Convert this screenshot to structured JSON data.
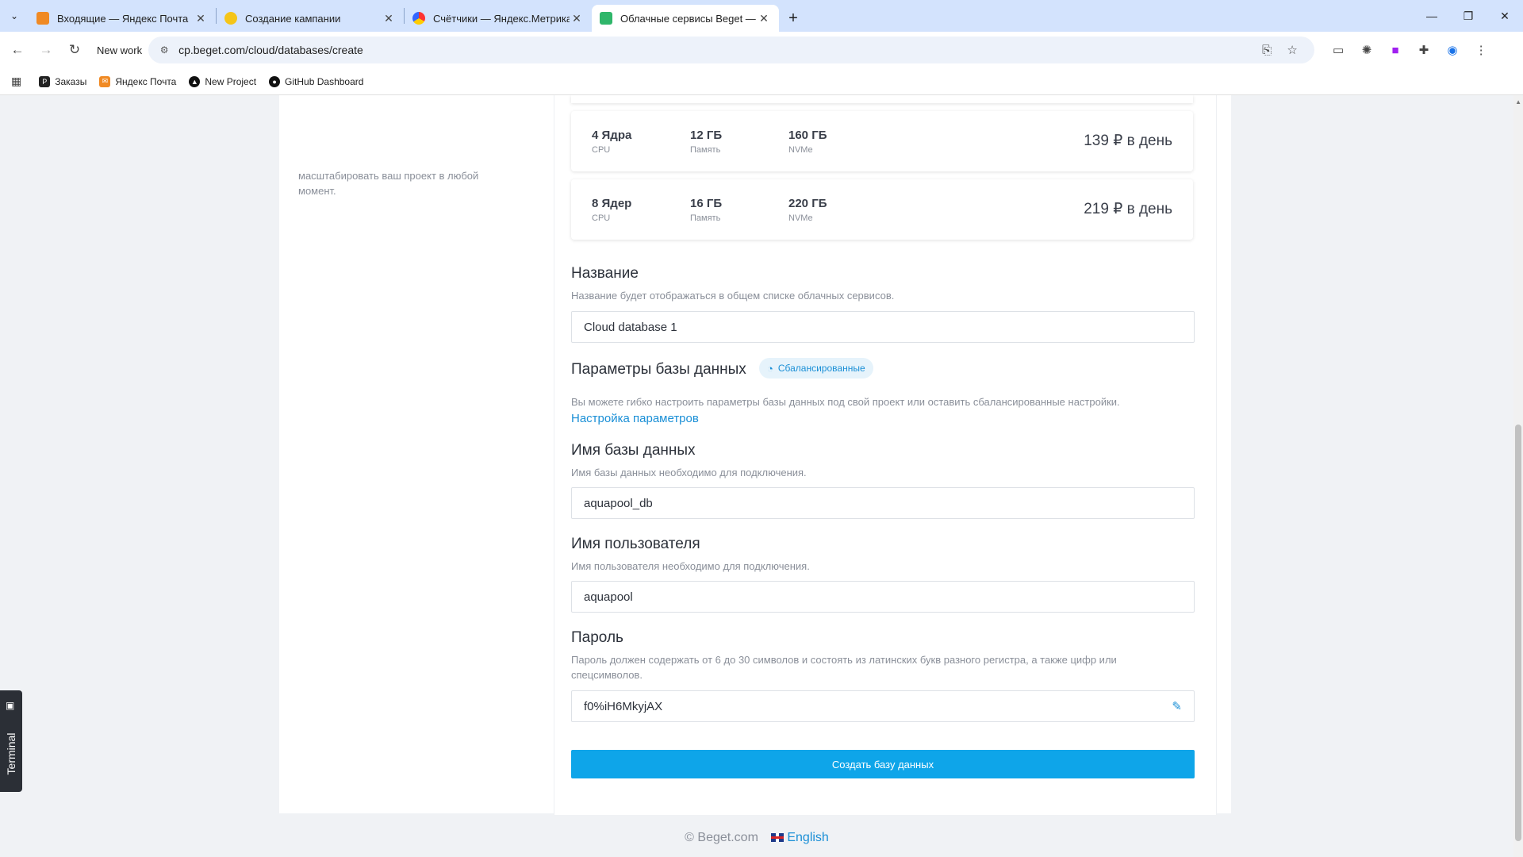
{
  "browser": {
    "tabs": [
      {
        "title": "Входящие — Яндекс Почта",
        "favicon_color": "#f08a24"
      },
      {
        "title": "Создание кампании",
        "favicon_color": "#f5c518"
      },
      {
        "title": "Счётчики — Яндекс.Метрика",
        "favicon_color": "#7a5cff"
      },
      {
        "title": "Облачные сервисы Beget — Г",
        "favicon_color": "#2fb66a"
      }
    ],
    "tab_close_glyph": "✕",
    "new_tab_glyph": "+",
    "profile_label": "New work",
    "url": "cp.beget.com/cloud/databases/create",
    "bookmarks": [
      {
        "label": "Заказы",
        "icon_color": "#222222",
        "icon_glyph": "P"
      },
      {
        "label": "Яндекс Почта",
        "icon_color": "#f08a24",
        "icon_glyph": "✉"
      },
      {
        "label": "New Project",
        "icon_color": "#111111",
        "icon_glyph": "▲"
      },
      {
        "label": "GitHub Dashboard",
        "icon_color": "#111111",
        "icon_glyph": "●"
      }
    ]
  },
  "page": {
    "left_text": {
      "line_cut": "масштабировать ваш проект в любой",
      "line2": "момент."
    },
    "plans": [
      {
        "cpu": "4 Ядра",
        "cpu_label": "CPU",
        "ram": "12 ГБ",
        "ram_label": "Память",
        "disk": "160 ГБ",
        "disk_label": "NVMe",
        "price": "139 ₽ в день"
      },
      {
        "cpu": "8 Ядер",
        "cpu_label": "CPU",
        "ram": "16 ГБ",
        "ram_label": "Память",
        "disk": "220 ГБ",
        "disk_label": "NVMe",
        "price": "219 ₽ в день"
      }
    ],
    "name": {
      "title": "Название",
      "desc": "Название будет отображаться в общем списке облачных сервисов.",
      "value": "Cloud database 1"
    },
    "db_params": {
      "title": "Параметры базы данных",
      "badge": "Сбалансированные",
      "desc": "Вы можете гибко настроить параметры базы данных под свой проект или оставить сбалансированные настройки.",
      "link": "Настройка параметров"
    },
    "db_name": {
      "title": "Имя базы данных",
      "desc": "Имя базы данных необходимо для подключения.",
      "value": "aquapool_db"
    },
    "user_name": {
      "title": "Имя пользователя",
      "desc": "Имя пользователя необходимо для подключения.",
      "value": "aquapool"
    },
    "password": {
      "title": "Пароль",
      "desc": "Пароль должен содержать от 6 до 30 символов и состоять из латинских букв разного регистра, а также цифр или спецсимволов.",
      "value": "f0%iH6MkyjAX"
    },
    "submit_label": "Создать базу данных",
    "footer": {
      "copyright": "© Beget.com",
      "language": "English"
    },
    "terminal_label": "Terminal"
  }
}
